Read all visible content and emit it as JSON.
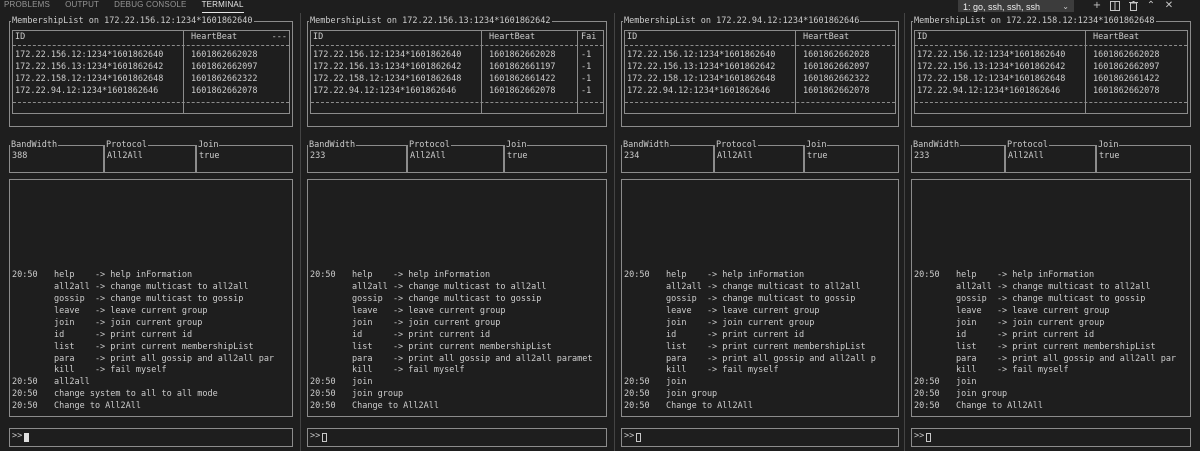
{
  "panel": {
    "tabs": [
      {
        "label": "PROBLEMS"
      },
      {
        "label": "OUTPUT"
      },
      {
        "label": "DEBUG CONSOLE"
      },
      {
        "label": "TERMINAL"
      }
    ],
    "terminal_select": "1: go, ssh, ssh, ssh",
    "icons": [
      "chevron-down-icon",
      "plus-icon",
      "split-terminal-icon",
      "trash-icon",
      "chevron-up-icon",
      "close-icon"
    ]
  },
  "labels": {
    "id_header": "ID",
    "heartbeat_header": "HeartBeat",
    "fail_header": "Fai",
    "more_header": "---",
    "bandwidth_title": "BandWidth",
    "protocol_title": "Protocol",
    "join_title": "Join"
  },
  "panes": [
    {
      "title": "MembershipList on 172.22.156.12:1234*1601862640",
      "show_fail": false,
      "show_more": true,
      "members": [
        {
          "id": "172.22.156.12:1234*1601862640",
          "hb": "1601862662028"
        },
        {
          "id": "172.22.156.13:1234*1601862642",
          "hb": "1601862662097"
        },
        {
          "id": "172.22.158.12:1234*1601862648",
          "hb": "1601862662322"
        },
        {
          "id": "172.22.94.12:1234*1601862646",
          "hb": "1601862662078"
        }
      ],
      "bandwidth": "388",
      "protocol": "All2All",
      "join": "true",
      "log": [
        {
          "time": "20:50",
          "text": "help    -> help inFormation"
        },
        {
          "time": "",
          "text": "all2all -> change multicast to all2all"
        },
        {
          "time": "",
          "text": "gossip  -> change multicast to gossip"
        },
        {
          "time": "",
          "text": "leave   -> leave current group"
        },
        {
          "time": "",
          "text": "join    -> join current group"
        },
        {
          "time": "",
          "text": "id      -> print current id"
        },
        {
          "time": "",
          "text": "list    -> print current membershipList"
        },
        {
          "time": "",
          "text": "para    -> print all gossip and all2all par"
        },
        {
          "time": "",
          "text": "kill    -> fail myself"
        },
        {
          "time": "20:50",
          "text": "all2all"
        },
        {
          "time": "20:50",
          "text": "change system to all to all mode"
        },
        {
          "time": "20:50",
          "text": "Change to All2All"
        }
      ],
      "prompt": ">>",
      "cursor_filled": true
    },
    {
      "title": "MembershipList on 172.22.156.13:1234*1601862642",
      "show_fail": true,
      "show_more": false,
      "members": [
        {
          "id": "172.22.156.12:1234*1601862640",
          "hb": "1601862662028",
          "fail": "-1"
        },
        {
          "id": "172.22.156.13:1234*1601862642",
          "hb": "1601862661197",
          "fail": "-1"
        },
        {
          "id": "172.22.158.12:1234*1601862648",
          "hb": "1601862661422",
          "fail": "-1"
        },
        {
          "id": "172.22.94.12:1234*1601862646",
          "hb": "1601862662078",
          "fail": "-1"
        }
      ],
      "bandwidth": "233",
      "protocol": "All2All",
      "join": "true",
      "log": [
        {
          "time": "20:50",
          "text": "help    -> help inFormation"
        },
        {
          "time": "",
          "text": "all2all -> change multicast to all2all"
        },
        {
          "time": "",
          "text": "gossip  -> change multicast to gossip"
        },
        {
          "time": "",
          "text": "leave   -> leave current group"
        },
        {
          "time": "",
          "text": "join    -> join current group"
        },
        {
          "time": "",
          "text": "id      -> print current id"
        },
        {
          "time": "",
          "text": "list    -> print current membershipList"
        },
        {
          "time": "",
          "text": "para    -> print all gossip and all2all paramet"
        },
        {
          "time": "",
          "text": "kill    -> fail myself"
        },
        {
          "time": "20:50",
          "text": "join"
        },
        {
          "time": "20:50",
          "text": "join group"
        },
        {
          "time": "20:50",
          "text": "Change to All2All"
        }
      ],
      "prompt": ">>",
      "cursor_filled": false
    },
    {
      "title": "MembershipList on 172.22.94.12:1234*1601862646",
      "show_fail": false,
      "show_more": false,
      "members": [
        {
          "id": "172.22.156.12:1234*1601862640",
          "hb": "1601862662028"
        },
        {
          "id": "172.22.156.13:1234*1601862642",
          "hb": "1601862662097"
        },
        {
          "id": "172.22.158.12:1234*1601862648",
          "hb": "1601862662322"
        },
        {
          "id": "172.22.94.12:1234*1601862646",
          "hb": "1601862662078"
        }
      ],
      "bandwidth": "234",
      "protocol": "All2All",
      "join": "true",
      "log": [
        {
          "time": "20:50",
          "text": "help    -> help inFormation"
        },
        {
          "time": "",
          "text": "all2all -> change multicast to all2all"
        },
        {
          "time": "",
          "text": "gossip  -> change multicast to gossip"
        },
        {
          "time": "",
          "text": "leave   -> leave current group"
        },
        {
          "time": "",
          "text": "join    -> join current group"
        },
        {
          "time": "",
          "text": "id      -> print current id"
        },
        {
          "time": "",
          "text": "list    -> print current membershipList"
        },
        {
          "time": "",
          "text": "para    -> print all gossip and all2all p"
        },
        {
          "time": "",
          "text": "kill    -> fail myself"
        },
        {
          "time": "20:50",
          "text": "join"
        },
        {
          "time": "20:50",
          "text": "join group"
        },
        {
          "time": "20:50",
          "text": "Change to All2All"
        }
      ],
      "prompt": ">>",
      "cursor_filled": false
    },
    {
      "title": "MembershipList on 172.22.158.12:1234*1601862648",
      "show_fail": false,
      "show_more": false,
      "members": [
        {
          "id": "172.22.156.12:1234*1601862640",
          "hb": "1601862662028"
        },
        {
          "id": "172.22.156.13:1234*1601862642",
          "hb": "1601862662097"
        },
        {
          "id": "172.22.158.12:1234*1601862648",
          "hb": "1601862661422"
        },
        {
          "id": "172.22.94.12:1234*1601862646",
          "hb": "1601862662078"
        }
      ],
      "bandwidth": "233",
      "protocol": "All2All",
      "join": "true",
      "log": [
        {
          "time": "20:50",
          "text": "help    -> help inFormation"
        },
        {
          "time": "",
          "text": "all2all -> change multicast to all2all"
        },
        {
          "time": "",
          "text": "gossip  -> change multicast to gossip"
        },
        {
          "time": "",
          "text": "leave   -> leave current group"
        },
        {
          "time": "",
          "text": "join    -> join current group"
        },
        {
          "time": "",
          "text": "id      -> print current id"
        },
        {
          "time": "",
          "text": "list    -> print current membershipList"
        },
        {
          "time": "",
          "text": "para    -> print all gossip and all2all par"
        },
        {
          "time": "",
          "text": "kill    -> fail myself"
        },
        {
          "time": "20:50",
          "text": "join"
        },
        {
          "time": "20:50",
          "text": "join group"
        },
        {
          "time": "20:50",
          "text": "Change to All2All"
        }
      ],
      "prompt": ">>",
      "cursor_filled": false
    }
  ]
}
